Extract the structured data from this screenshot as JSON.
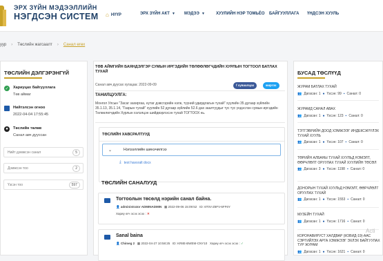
{
  "header": {
    "logo_line1": "ЭРХ ЗҮЙН МЭДЭЭЛЛИЙН",
    "logo_line2": "НЭГДСЭН СИСТЕМ",
    "nav": [
      "НҮҮР",
      "ЭРХ ЗҮЙН АКТ",
      "МЭДЭЭ",
      "ХУУЛИЙН НЭР ТОМЬЁО",
      "БАЙГУУЛЛАГА",
      "ҮНДСЭН ХУУЛЬ"
    ]
  },
  "breadcrumb": {
    "items": [
      "уур",
      "Төслийн жагсаалт",
      "Санал өгөх"
    ]
  },
  "left_panel": {
    "title": "ТӨСЛИЙН ДЭЛГЭРЭНГҮЙ",
    "org_label": "Хариуцах байгууллага",
    "org_value": "Төв аймаг",
    "date_label": "Нийтэлсэн огноо",
    "date_value": "2022-04-04 17:55:45",
    "status_label": "Төслийн төлөв",
    "status_value": "Санал авч дууссан",
    "counts": [
      {
        "label": "Нийт дэмжсэн санал",
        "value": "5"
      },
      {
        "label": "Дэмжсэн тоо",
        "value": "2"
      },
      {
        "label": "Үзсэн тоо",
        "value": "597"
      }
    ]
  },
  "main": {
    "title": "ТӨВ АЙМГИЙН БАЯНДЭЛГЭР СУМЫН ИРГЭДИЙН ТӨЛӨӨЛӨГЧДИЙН ХУРЛЫН ТОГТООЛ БАТЛАХ ТУХАЙ",
    "meta": "Санал авч дуусах хугацаа: 2022-09-09",
    "share_facebook": "f хуваалцах",
    "share_twitter": "жиргэх",
    "description_heading": "ТАНИЛЦУУЛГА:",
    "description": "Монгол Улсын \"Засаг захиргаа, нутаг дэвсгэрийн нэгж, түүний удирдлагын тухай\" хуулийн 35 дугаар зүйлийн 35.1.13, 35.1.14, \"Газрын тухай\" хуулийн 52 дугаар зүйлийн 52.6 дах заалтуудыг тус тус үндэслэн сумын иргэдийн Төлөөлөгчдийн Хурлын хэлэлцэн шийдвэрлэсэн тухай ТОГТООХ нь.",
    "attachments": {
      "heading": "ТӨСЛИЙН ХАВСРАЛТУУД",
      "accordion_title": "Нэлээллийн шинэчилгээ",
      "file": "test havsralt docx"
    },
    "suggestions_heading": "ТӨСЛИЙН САНАЛУУД",
    "suggestions": [
      {
        "title": "Тогтоолын төсөлд нэрийн санал байна.",
        "author": "administrator ADMINADMIN",
        "date": "2022-09-06 15:09:52",
        "id": "ID: 6T0V-Z8FV-6FF6Y",
        "vote_label": "Хариу өгч эсэх эсэх :",
        "vote_mark": "✕"
      },
      {
        "title": "Sanal baina",
        "author": "Chimeg 2",
        "date": "2022-04-27 10:58:25",
        "id": "ID: KR8E-BWEM-CNY10",
        "vote_label": "Хариу өгч эсэх эсэх :",
        "vote_mark": "✓"
      }
    ]
  },
  "sidebar": {
    "title": "БУСАД ТӨСЛҮҮД",
    "items": [
      {
        "title": "ЖУРАМ БАТЛАХ ТУХАЙ",
        "followers": "Дагасан: 1",
        "views": "Үзсэн: 99",
        "comments": "Санал: 0"
      },
      {
        "title": "ЖУРАМД САНАЛ АВАХ",
        "followers": "Дагасан: 1",
        "views": "Үзсэн: 123",
        "comments": "Санал: 0"
      },
      {
        "title": "ТЭТГЭВРИЙН ДООД ХЭМЖЭЭГ ИНДЕКСЖҮҮЛЭХ ТУХАЙ ХУУЛЬ",
        "followers": "Дагасан: 1",
        "views": "Үзсэн: 107",
        "comments": "Санал: 0"
      },
      {
        "title": "ТӨРИЙН АЛБАНЫ ТУХАЙ ХУУЛЬД НЭМЭЛТ, ӨӨРЧЛӨЛТ ОРУУЛАХ ТУХАЙ ХУУЛИЙН ТӨСӨЛ",
        "followers": "Дагасан: 3",
        "views": "Үзсэн: 1198",
        "comments": "Санал: 0"
      },
      {
        "title": "ДОНОРЫН ТУХАЙ ХУУЛЬД НЭМЭЛТ, ӨӨРЧЛӨЛТ ОРУУЛАХ ТУХАЙ",
        "followers": "Дагасан: 1",
        "views": "Үзсэн: 1553",
        "comments": "Санал: 0"
      },
      {
        "title": "МУЗЕЙН ТУХАЙ",
        "followers": "Дагасан: 1",
        "views": "Үзсэн: 1716",
        "comments": "Санал: 0"
      },
      {
        "title": "КОРОНАВИРУСТ ХАЛДВАР (КОВИД-19)-ААС СЭРГИЙЛЭХ АРГА ХЭМЖЭЭГ ЭХЛЭХ БАЙГУУЛАХ ТУР ЖУРАМ",
        "followers": "Дагасан: 1",
        "views": "Үзсэн: 1621",
        "comments": "Санал: 0"
      }
    ]
  },
  "watermark": "Acti"
}
